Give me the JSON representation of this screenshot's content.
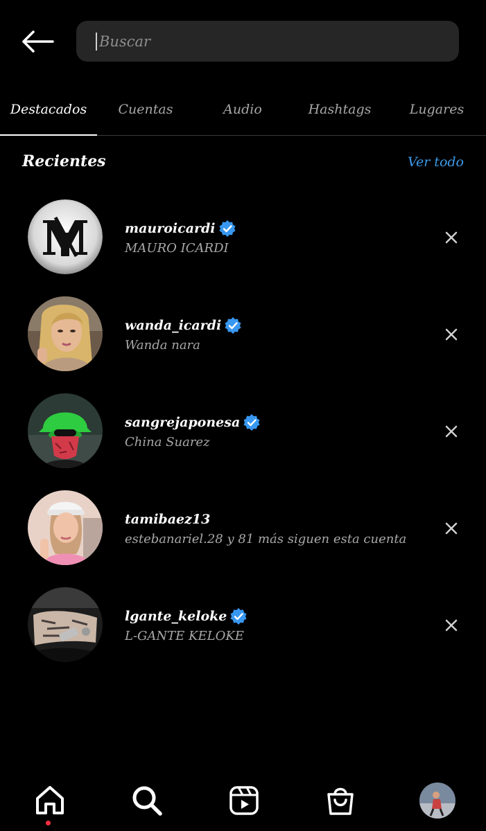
{
  "search": {
    "placeholder": "Buscar",
    "back_icon": "arrow-left-icon"
  },
  "tabs": [
    {
      "label": "Destacados",
      "active": true
    },
    {
      "label": "Cuentas",
      "active": false
    },
    {
      "label": "Audio",
      "active": false
    },
    {
      "label": "Hashtags",
      "active": false
    },
    {
      "label": "Lugares",
      "active": false
    }
  ],
  "recents": {
    "title": "Recientes",
    "see_all": "Ver todo",
    "accent_color": "#3d9be9",
    "items": [
      {
        "username": "mauroicardi",
        "subtitle": "MAURO ICARDI",
        "verified": true
      },
      {
        "username": "wanda_icardi",
        "subtitle": "Wanda nara",
        "verified": true
      },
      {
        "username": "sangrejaponesa",
        "subtitle": "China Suarez",
        "verified": true
      },
      {
        "username": "tamibaez13",
        "subtitle": "estebanariel.28 y 81 más siguen esta cuenta",
        "verified": false
      },
      {
        "username": "lgante_keloke",
        "subtitle": "L-GANTE KELOKE",
        "verified": true
      }
    ]
  },
  "bottom_nav": [
    {
      "name": "home-icon",
      "active": true
    },
    {
      "name": "search-icon",
      "active": false
    },
    {
      "name": "reels-icon",
      "active": false
    },
    {
      "name": "shop-icon",
      "active": false
    },
    {
      "name": "profile-avatar",
      "active": false
    }
  ],
  "colors": {
    "background": "#000000",
    "search_bg": "#262626",
    "verified_blue": "#3897f0",
    "notification_dot": "#ff3040"
  }
}
